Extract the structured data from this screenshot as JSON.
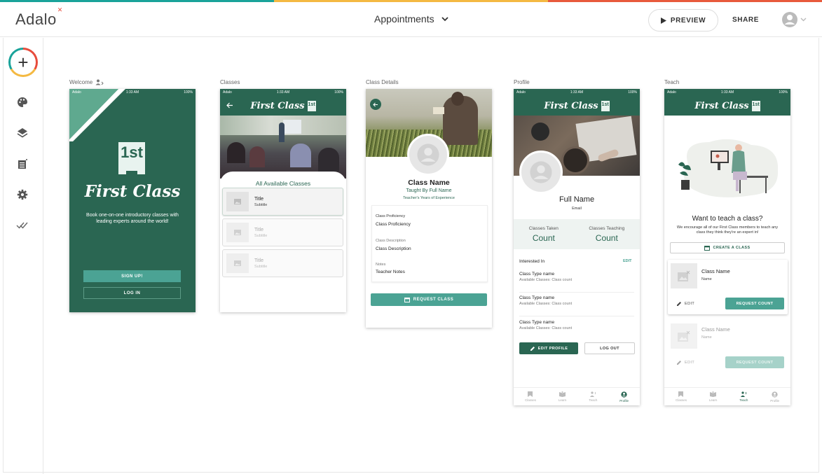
{
  "colors": {
    "stripe": [
      "#1aa39a",
      "#f4b942",
      "#e85a3c"
    ],
    "app_green": "#2a6652",
    "teal": "#4ba394"
  },
  "header": {
    "logo": "Adalo",
    "screen_select": "Appointments",
    "preview_label": "PREVIEW",
    "share_label": "SHARE"
  },
  "sidebar": {
    "icons": [
      "add-icon",
      "palette-icon",
      "layers-icon",
      "database-icon",
      "gear-icon",
      "publish-check-icon"
    ]
  },
  "screens": {
    "welcome": {
      "label": "Welcome",
      "status_left": "Adalo",
      "status_time": "1:33 AM",
      "status_right": "100%",
      "badge": "1st",
      "title": "First Class",
      "tagline": "Book one-on-one introductory classes with leading experts around the world!",
      "signup": "SIGN UP!",
      "login": "LOG IN"
    },
    "classes": {
      "label": "Classes",
      "status_left": "Adalo",
      "status_time": "1:33 AM",
      "status_right": "100%",
      "brand": "First Class",
      "badge": "1st",
      "section_title": "All Available Classes",
      "items": [
        {
          "title": "Title",
          "subtitle": "Subtitle"
        },
        {
          "title": "Title",
          "subtitle": "Subtitle"
        },
        {
          "title": "Title",
          "subtitle": "Subtitle"
        }
      ]
    },
    "class_details": {
      "label": "Class Details",
      "class_name": "Class Name",
      "taught_by": "Taught By Full Name",
      "experience": "Teacher's Years of Experience",
      "fields": [
        {
          "label": "Class Proficiency",
          "value": "Class Proficiency"
        },
        {
          "label": "Class Description",
          "value": "Class Description"
        },
        {
          "label": "Notes",
          "value": "Teacher Notes"
        }
      ],
      "request_btn": "REQUEST CLASS"
    },
    "profile": {
      "label": "Profile",
      "status_left": "Adalo",
      "status_time": "1:33 AM",
      "status_right": "100%",
      "brand": "First Class",
      "badge": "1st",
      "full_name": "Full Name",
      "email": "Email",
      "stats": [
        {
          "label": "Classes Taken",
          "value": "Count"
        },
        {
          "label": "Classes Teaching",
          "value": "Count"
        }
      ],
      "interested_in": "Interested In",
      "edit": "EDIT",
      "class_types": [
        {
          "name": "Class Type name",
          "sub": "Available Classes: Class count"
        },
        {
          "name": "Class Type name",
          "sub": "Available Classes: Class count"
        },
        {
          "name": "Class Type name",
          "sub": "Available Classes: Class count"
        }
      ],
      "edit_profile": "EDIT PROFILE",
      "log_out": "LOG OUT",
      "tabs": [
        "Classes",
        "Learn",
        "Teach",
        "Profile"
      ]
    },
    "teach": {
      "label": "Teach",
      "status_left": "Adalo",
      "status_time": "1:33 AM",
      "status_right": "100%",
      "brand": "First Class",
      "badge": "1st",
      "heading": "Want to teach a class?",
      "body": "We encourage all of our First Class members to teach any class they think they're an expert in!",
      "create_btn": "CREATE A CLASS",
      "cards": [
        {
          "name": "Class Name",
          "sub": "Name",
          "edit": "EDIT",
          "request": "REQUEST COUNT"
        },
        {
          "name": "Class Name",
          "sub": "Name",
          "edit": "EDIT",
          "request": "REQUEST COUNT"
        }
      ],
      "tabs": [
        "Classes",
        "Learn",
        "Teach",
        "Profile"
      ]
    }
  }
}
